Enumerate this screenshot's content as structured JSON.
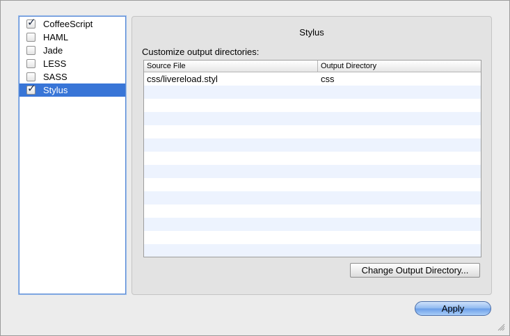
{
  "languages": [
    {
      "label": "CoffeeScript",
      "checked": true,
      "selected": false
    },
    {
      "label": "HAML",
      "checked": false,
      "selected": false
    },
    {
      "label": "Jade",
      "checked": false,
      "selected": false
    },
    {
      "label": "LESS",
      "checked": false,
      "selected": false
    },
    {
      "label": "SASS",
      "checked": false,
      "selected": false
    },
    {
      "label": "Stylus",
      "checked": true,
      "selected": true
    }
  ],
  "panel": {
    "title": "Stylus",
    "subtitle": "Customize output directories:",
    "table": {
      "columns": [
        "Source File",
        "Output Directory"
      ],
      "rows": [
        [
          "css/livereload.styl",
          "css"
        ]
      ]
    },
    "change_button_label": "Change Output Directory..."
  },
  "footer": {
    "apply_label": "Apply"
  },
  "colors": {
    "selection": "#3875d7",
    "alt_row": "#edf3fe",
    "apply_button": "#8fb9f0"
  }
}
